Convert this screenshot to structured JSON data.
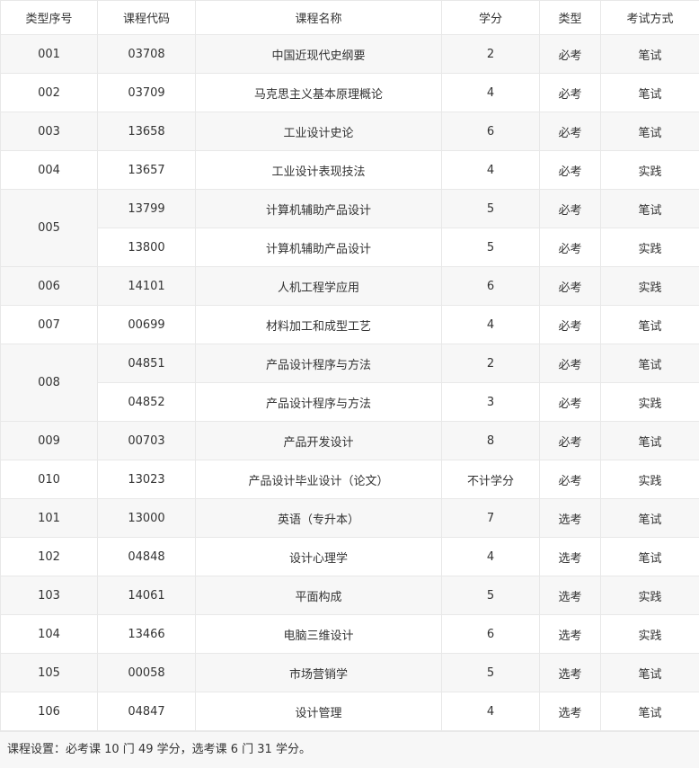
{
  "table": {
    "headers": [
      "类型序号",
      "课程代码",
      "课程名称",
      "学分",
      "类型",
      "考试方式"
    ],
    "rows": [
      {
        "seq": "001",
        "code": "03708",
        "name": "中国近现代史纲要",
        "credit": "2",
        "type": "必考",
        "exam": "笔试"
      },
      {
        "seq": "002",
        "code": "03709",
        "name": "马克思主义基本原理概论",
        "credit": "4",
        "type": "必考",
        "exam": "笔试"
      },
      {
        "seq": "003",
        "code": "13658",
        "name": "工业设计史论",
        "credit": "6",
        "type": "必考",
        "exam": "笔试"
      },
      {
        "seq": "004",
        "code": "13657",
        "name": "工业设计表现技法",
        "credit": "4",
        "type": "必考",
        "exam": "实践"
      },
      {
        "seq": "005",
        "code": "13799",
        "name": "计算机辅助产品设计",
        "credit": "5",
        "type": "必考",
        "exam": "笔试"
      },
      {
        "seq": "",
        "code": "13800",
        "name": "计算机辅助产品设计",
        "credit": "5",
        "type": "必考",
        "exam": "实践"
      },
      {
        "seq": "006",
        "code": "14101",
        "name": "人机工程学应用",
        "credit": "6",
        "type": "必考",
        "exam": "实践"
      },
      {
        "seq": "007",
        "code": "00699",
        "name": "材料加工和成型工艺",
        "credit": "4",
        "type": "必考",
        "exam": "笔试"
      },
      {
        "seq": "008",
        "code": "04851",
        "name": "产品设计程序与方法",
        "credit": "2",
        "type": "必考",
        "exam": "笔试"
      },
      {
        "seq": "",
        "code": "04852",
        "name": "产品设计程序与方法",
        "credit": "3",
        "type": "必考",
        "exam": "实践"
      },
      {
        "seq": "009",
        "code": "00703",
        "name": "产品开发设计",
        "credit": "8",
        "type": "必考",
        "exam": "笔试"
      },
      {
        "seq": "010",
        "code": "13023",
        "name": "产品设计毕业设计（论文）",
        "credit": "不计学分",
        "type": "必考",
        "exam": "实践"
      },
      {
        "seq": "101",
        "code": "13000",
        "name": "英语（专升本）",
        "credit": "7",
        "type": "选考",
        "exam": "笔试"
      },
      {
        "seq": "102",
        "code": "04848",
        "name": "设计心理学",
        "credit": "4",
        "type": "选考",
        "exam": "笔试"
      },
      {
        "seq": "103",
        "code": "14061",
        "name": "平面构成",
        "credit": "5",
        "type": "选考",
        "exam": "实践"
      },
      {
        "seq": "104",
        "code": "13466",
        "name": "电脑三维设计",
        "credit": "6",
        "type": "选考",
        "exam": "实践"
      },
      {
        "seq": "105",
        "code": "00058",
        "name": "市场营销学",
        "credit": "5",
        "type": "选考",
        "exam": "笔试"
      },
      {
        "seq": "106",
        "code": "04847",
        "name": "设计管理",
        "credit": "4",
        "type": "选考",
        "exam": "笔试"
      }
    ]
  },
  "footer": {
    "note": "课程设置：必考课 10 门 49 学分，选考课 6 门 31 学分。"
  },
  "colors": {
    "stripe": "#f7f7f7",
    "border": "#e8e8e8",
    "text": "#333333"
  }
}
